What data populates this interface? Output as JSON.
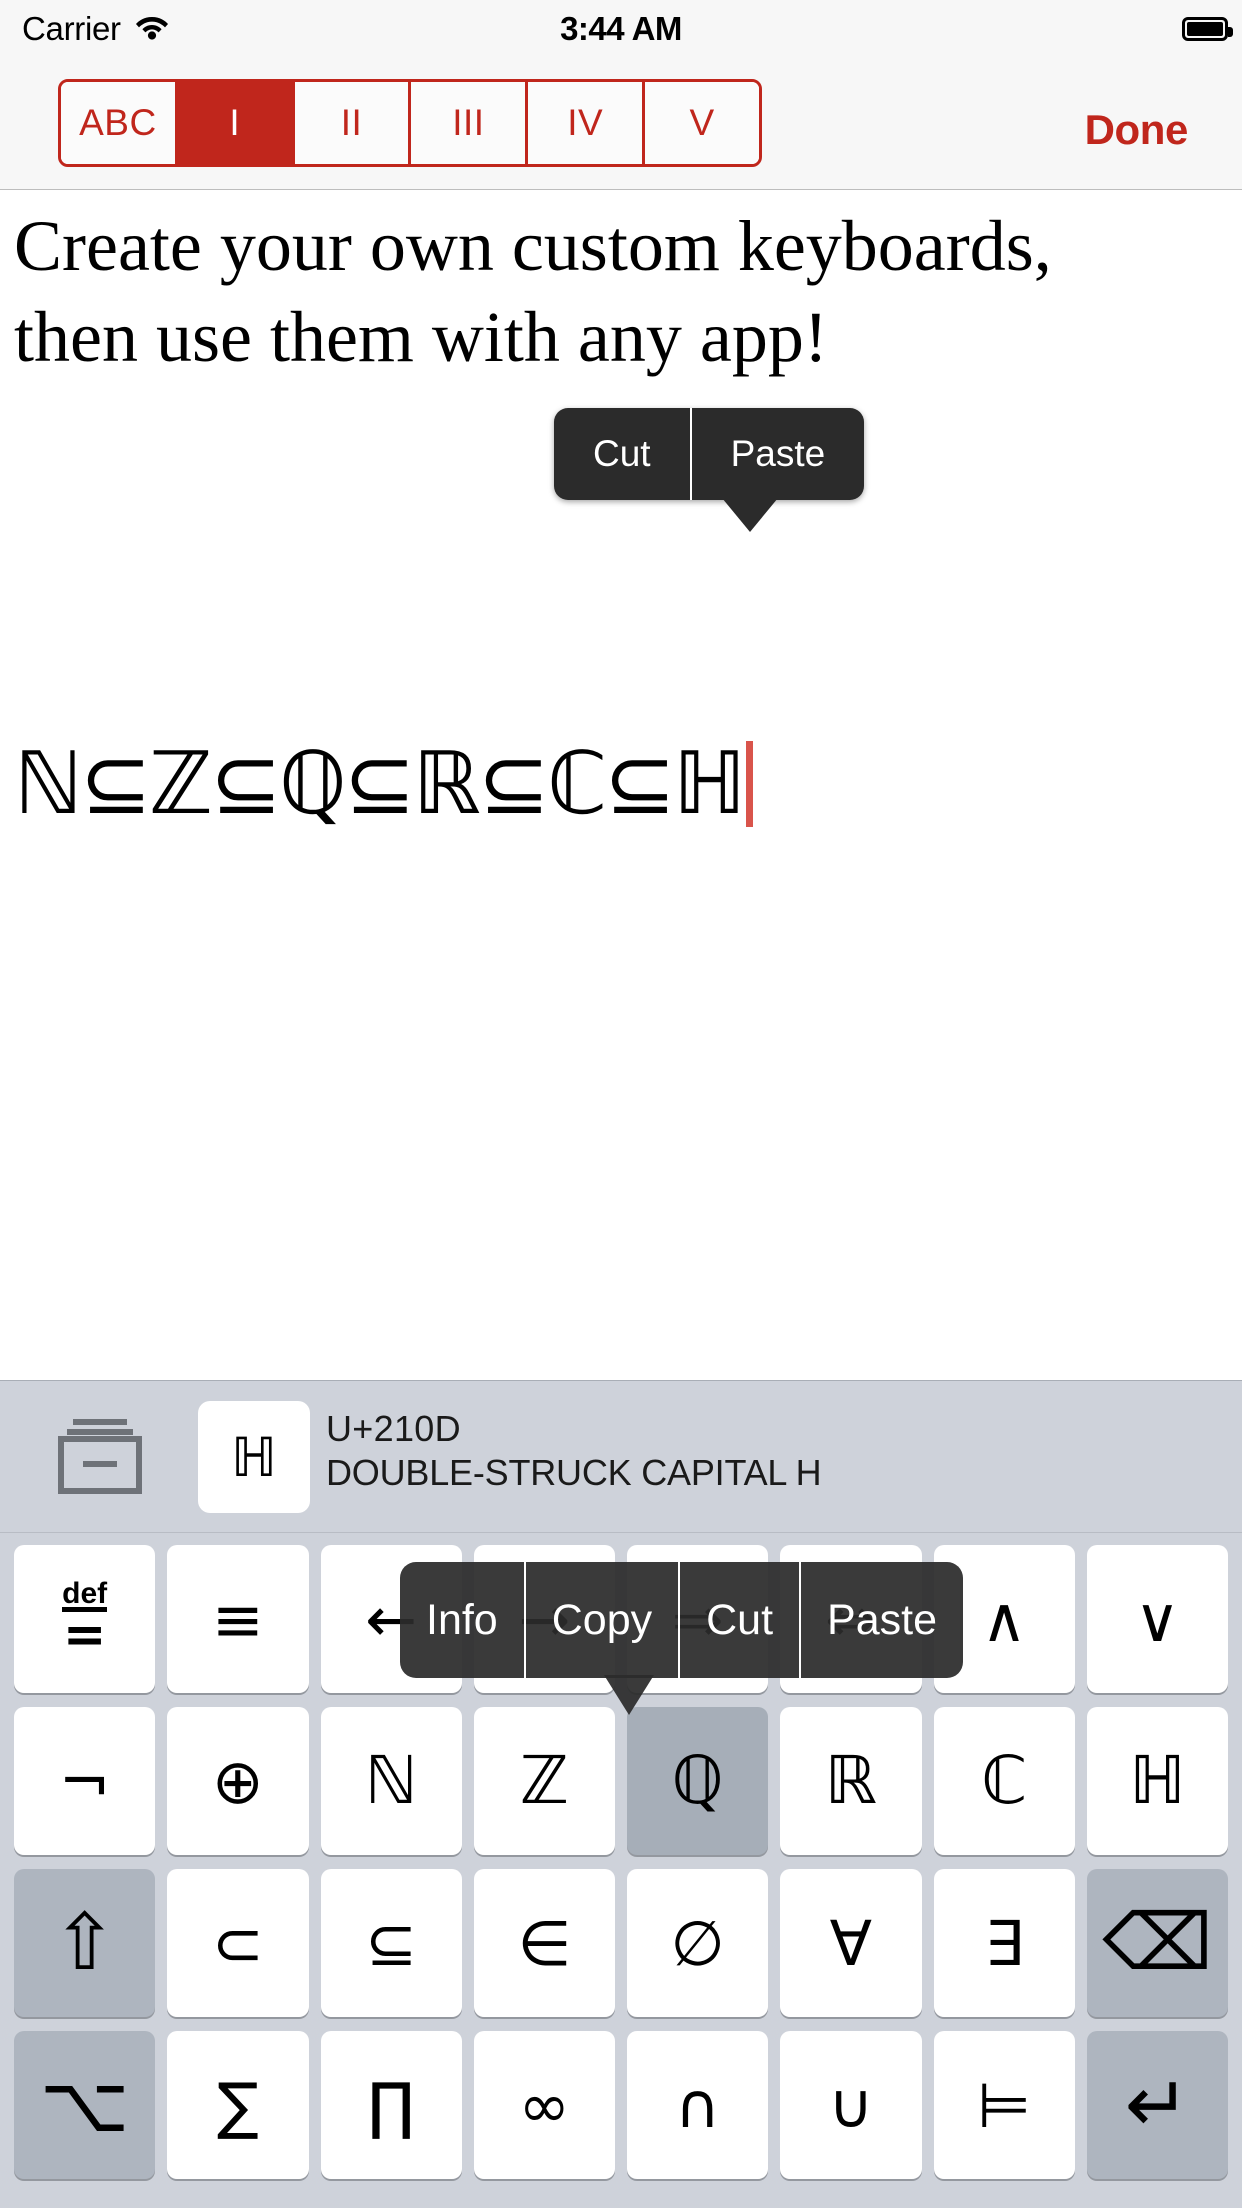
{
  "status_bar": {
    "carrier": "Carrier",
    "wifi_icon": "wifi-icon",
    "time": "3:44 AM",
    "battery_icon": "battery-full-icon"
  },
  "nav_bar": {
    "segments": [
      {
        "label": "ABC",
        "selected": false
      },
      {
        "label": "I",
        "selected": true
      },
      {
        "label": "II",
        "selected": false
      },
      {
        "label": "III",
        "selected": false
      },
      {
        "label": "IV",
        "selected": false
      },
      {
        "label": "V",
        "selected": false
      }
    ],
    "done_label": "Done",
    "accent_color": "#C0261C"
  },
  "text_area": {
    "body_text": "Create your own custom keyboards, then use them with any app!",
    "math_line": "ℕ⊆ℤ⊆ℚ⊆ℝ⊆ℂ⊆ℍ",
    "caret_color": "#D9544B"
  },
  "edit_callout": {
    "items": [
      "Cut",
      "Paste"
    ]
  },
  "keyboard": {
    "background_color": "#CED2DA",
    "deck_icon": "card-deck-icon",
    "preview": {
      "glyph": "ℍ",
      "code": "U+210D",
      "name": "DOUBLE-STRUCK CAPITAL H"
    },
    "popup": {
      "items": [
        "Info",
        "Copy",
        "Cut",
        "Paste"
      ]
    },
    "rows": [
      [
        {
          "glyph": "def-equals",
          "name": "key-def-equals",
          "type": "def"
        },
        {
          "glyph": "≡",
          "name": "key-identical-to",
          "type": "sym"
        },
        {
          "glyph": "←",
          "name": "key-leftwards-arrow",
          "type": "sym"
        },
        {
          "glyph": "→",
          "name": "key-rightwards-arrow",
          "type": "sym"
        },
        {
          "glyph": "⇒",
          "name": "key-rightwards-double-arrow",
          "type": "sym"
        },
        {
          "glyph": "⇔",
          "name": "key-left-right-double-arrow",
          "type": "sym"
        },
        {
          "glyph": "∧",
          "name": "key-logical-and",
          "type": "sym"
        },
        {
          "glyph": "∨",
          "name": "key-logical-or",
          "type": "sym"
        }
      ],
      [
        {
          "glyph": "¬",
          "name": "key-not-sign",
          "type": "sym"
        },
        {
          "glyph": "⊕",
          "name": "key-circled-plus",
          "type": "sym"
        },
        {
          "glyph": "ℕ",
          "name": "key-double-struck-n",
          "type": "serif"
        },
        {
          "glyph": "ℤ",
          "name": "key-double-struck-z",
          "type": "serif"
        },
        {
          "glyph": "ℚ",
          "name": "key-double-struck-q",
          "type": "serif",
          "pressed": true
        },
        {
          "glyph": "ℝ",
          "name": "key-double-struck-r",
          "type": "serif"
        },
        {
          "glyph": "ℂ",
          "name": "key-double-struck-c",
          "type": "serif"
        },
        {
          "glyph": "ℍ",
          "name": "key-double-struck-h",
          "type": "serif"
        }
      ],
      [
        {
          "glyph": "⇧",
          "name": "key-shift",
          "type": "mod"
        },
        {
          "glyph": "⊂",
          "name": "key-subset-of",
          "type": "sym"
        },
        {
          "glyph": "⊆",
          "name": "key-subset-of-or-equal-to",
          "type": "sym"
        },
        {
          "glyph": "∈",
          "name": "key-element-of",
          "type": "sym"
        },
        {
          "glyph": "∅",
          "name": "key-empty-set",
          "type": "sym"
        },
        {
          "glyph": "∀",
          "name": "key-for-all",
          "type": "sym"
        },
        {
          "glyph": "∃",
          "name": "key-there-exists",
          "type": "sym"
        },
        {
          "glyph": "⌫",
          "name": "key-backspace",
          "type": "mod"
        }
      ],
      [
        {
          "glyph": "⌥",
          "name": "key-option",
          "type": "mod"
        },
        {
          "glyph": "∑",
          "name": "key-n-ary-summation",
          "type": "sym"
        },
        {
          "glyph": "∏",
          "name": "key-n-ary-product",
          "type": "sym"
        },
        {
          "glyph": "∞",
          "name": "key-infinity",
          "type": "sym"
        },
        {
          "glyph": "∩",
          "name": "key-intersection",
          "type": "sym"
        },
        {
          "glyph": "∪",
          "name": "key-union",
          "type": "sym"
        },
        {
          "glyph": "⊨",
          "name": "key-true-models",
          "type": "sym"
        },
        {
          "glyph": "↵",
          "name": "key-return",
          "type": "mod"
        }
      ]
    ]
  }
}
